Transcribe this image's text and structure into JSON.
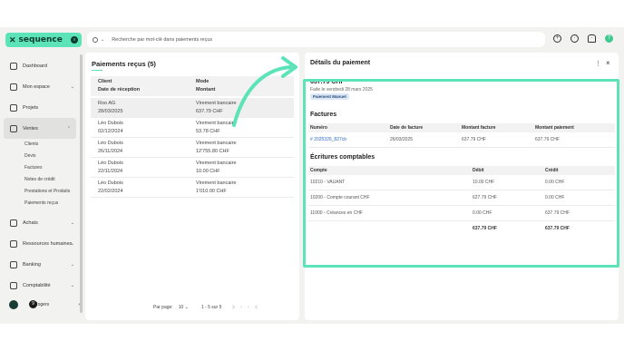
{
  "brand": {
    "name": "sequence"
  },
  "search": {
    "placeholder": "Recherche par mot-clé dans paiements reçus"
  },
  "sidebar": {
    "items": [
      {
        "label": "Dashboard"
      },
      {
        "label": "Mon espace"
      },
      {
        "label": "Projets"
      },
      {
        "label": "Ventes"
      },
      {
        "label": "Achats"
      },
      {
        "label": "Ressources humaines"
      },
      {
        "label": "Banking"
      },
      {
        "label": "Comptabilité"
      }
    ],
    "sub": [
      "Clients",
      "Devis",
      "Factures",
      "Notes de crédit",
      "Prestations et Produits",
      "Paiements reçus"
    ],
    "user": {
      "name": "Rogers",
      "badge": "9"
    }
  },
  "left": {
    "title": "Paiements reçus (5)",
    "headers": {
      "client": "Client",
      "date": "Date de réception",
      "mode": "Mode",
      "amount": "Montant"
    },
    "rows": [
      {
        "client": "Roo AG",
        "date": "28/03/2025",
        "mode": "Virement bancaire",
        "amount": "637.79 CHF"
      },
      {
        "client": "Léo Dubois",
        "date": "02/12/2024",
        "mode": "Virement bancaire",
        "amount": "53.78 CHF"
      },
      {
        "client": "Léo Dubois",
        "date": "26/11/2024",
        "mode": "Virement bancaire",
        "amount": "12'755.80 CHF"
      },
      {
        "client": "Léo Dubois",
        "date": "22/11/2024",
        "mode": "Virement bancaire",
        "amount": "10.00 CHF"
      },
      {
        "client": "Léo Dubois",
        "date": "22/02/2024",
        "mode": "Virement bancaire",
        "amount": "1'010.00 CHF"
      }
    ],
    "pager": {
      "label": "Par page:",
      "per": "10",
      "range": "1 - 5 sur 5"
    }
  },
  "right": {
    "title": "Détails du paiement",
    "amount": "637.79 CHF",
    "made": "Faite le vendredi 28 mars 2025",
    "tag": "Paiement Manuel",
    "factures": {
      "title": "Factures",
      "headers": [
        "Numéro",
        "Date de facture",
        "Montant facture",
        "Montant paiement"
      ],
      "row": [
        "# 2025326_827cb",
        "26/03/2025",
        "637.79 CHF",
        "637.79 CHF"
      ]
    },
    "ecritures": {
      "title": "Écritures comptables",
      "headers": [
        "Compte",
        "Débit",
        "Crédit"
      ],
      "rows": [
        [
          "10210 - VAUANT",
          "10.00 CHF",
          "0.00 CHF"
        ],
        [
          "10200 - Compte courant CHF",
          "627.79 CHF",
          "0.00 CHF"
        ],
        [
          "11000 - Créances en CHF",
          "0.00 CHF",
          "637.79 CHF"
        ]
      ],
      "total": [
        "637.79 CHF",
        "637.79 CHF"
      ]
    }
  },
  "colors": {
    "accent": "#5de3b8"
  }
}
